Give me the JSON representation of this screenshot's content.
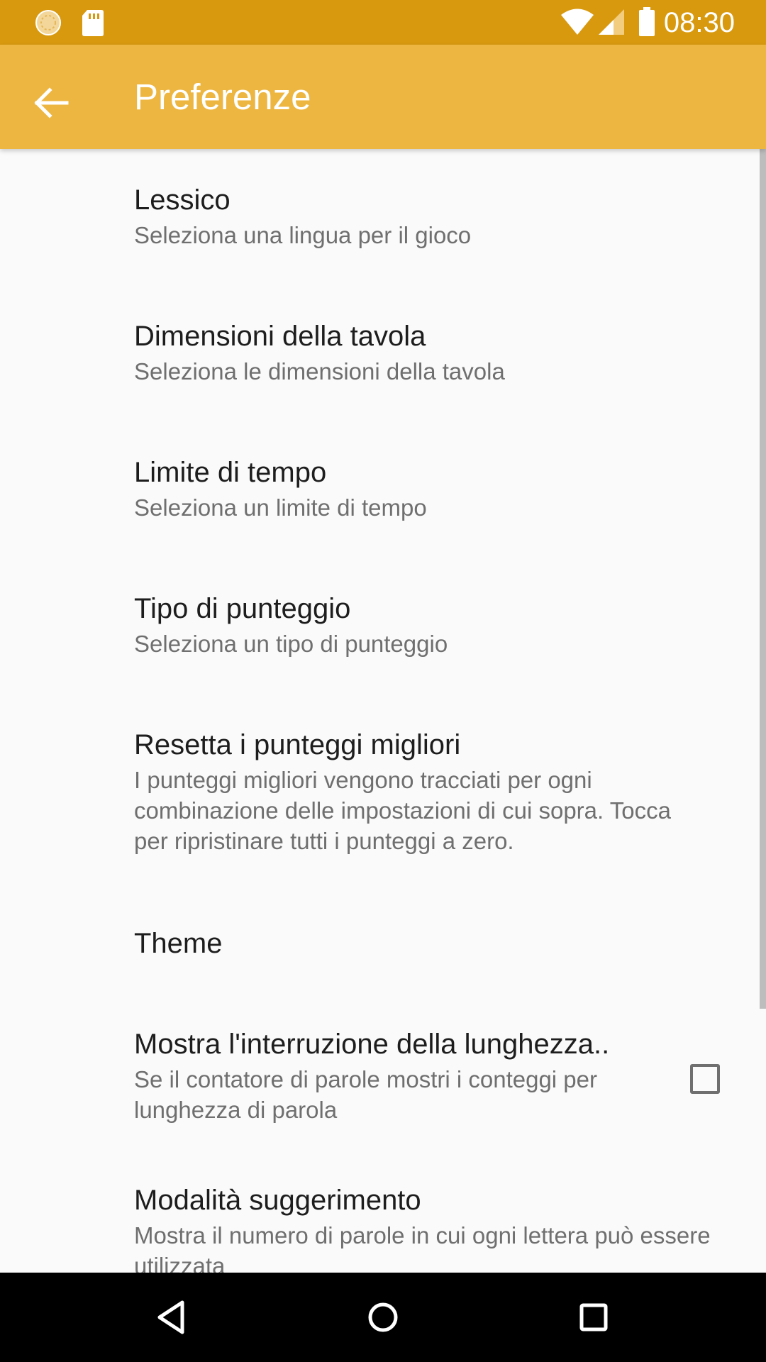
{
  "status_bar": {
    "time": "08:30",
    "left_icons": [
      "sync-icon",
      "sd-card-icon"
    ],
    "right_icons": [
      "wifi-icon",
      "cell-signal-icon",
      "battery-icon"
    ]
  },
  "app_bar": {
    "title": "Preferenze",
    "back_icon": "arrow-back-icon"
  },
  "preferences": [
    {
      "title": "Lessico",
      "summary": "Seleziona una lingua per il gioco"
    },
    {
      "title": "Dimensioni della tavola",
      "summary": "Seleziona le dimensioni della tavola"
    },
    {
      "title": "Limite di tempo",
      "summary": "Seleziona un limite di tempo"
    },
    {
      "title": "Tipo di punteggio",
      "summary": "Seleziona un tipo di punteggio"
    },
    {
      "title": "Resetta i punteggi migliori",
      "summary": "I punteggi migliori vengono tracciati per ogni combinazione delle impostazioni di cui sopra. Tocca per ripristinare tutti i punteggi a zero."
    },
    {
      "title": "Theme",
      "summary": ""
    },
    {
      "title": "Mostra l'interruzione della lunghezza..",
      "summary": "Se il contatore di parole mostri i conteggi per lunghezza di parola",
      "checked": false
    },
    {
      "title": "Modalità suggerimento",
      "summary": "Mostra il numero di parole in cui ogni lettera può essere utilizzata"
    }
  ],
  "nav_bar": {
    "icons": [
      "back-triangle-icon",
      "home-circle-icon",
      "recents-square-icon"
    ]
  },
  "colors": {
    "status_bar": "#D8990F",
    "app_bar": "#EDB641",
    "background": "#FAFAFA",
    "title_text": "#1D1D1D",
    "summary_text": "#6F6F6F"
  }
}
